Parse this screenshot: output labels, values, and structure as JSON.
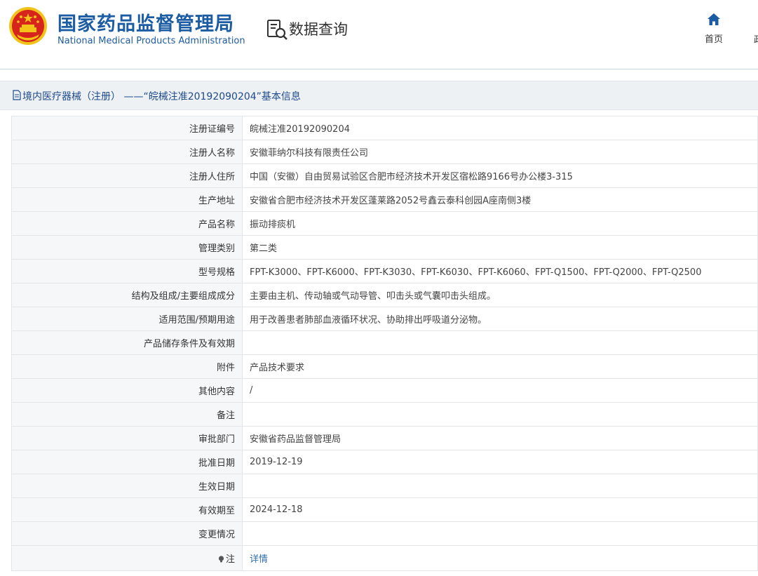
{
  "header": {
    "org_name_cn": "国家药品监督管理局",
    "org_name_en": "National Medical Products Administration",
    "section_title": "数据查询",
    "nav_home": "首页",
    "nav_next_partial": "政"
  },
  "page": {
    "title": "境内医疗器械（注册） ——“皖械注准20192090204”基本信息"
  },
  "rows": [
    {
      "label": "注册证编号",
      "value": "皖械注准20192090204"
    },
    {
      "label": "注册人名称",
      "value": "安徽菲纳尔科技有限责任公司"
    },
    {
      "label": "注册人住所",
      "value": "中国（安徽）自由贸易试验区合肥市经济技术开发区宿松路9166号办公楼3-315"
    },
    {
      "label": "生产地址",
      "value": "安徽省合肥市经济技术开发区蓬莱路2052号鑫云泰科创园A座南侧3楼"
    },
    {
      "label": "产品名称",
      "value": "振动排痰机"
    },
    {
      "label": "管理类别",
      "value": "第二类"
    },
    {
      "label": "型号规格",
      "value": "FPT-K3000、FPT-K6000、FPT-K3030、FPT-K6030、FPT-K6060、FPT-Q1500、FPT-Q2000、FPT-Q2500"
    },
    {
      "label": "结构及组成/主要组成成分",
      "value": "主要由主机、传动轴或气动导管、叩击头或气囊叩击头组成。"
    },
    {
      "label": "适用范围/预期用途",
      "value": "用于改善患者肺部血液循环状况、协助排出呼吸道分泌物。"
    },
    {
      "label": "产品储存条件及有效期",
      "value": ""
    },
    {
      "label": "附件",
      "value": "产品技术要求"
    },
    {
      "label": "其他内容",
      "value": "/"
    },
    {
      "label": "备注",
      "value": ""
    },
    {
      "label": "审批部门",
      "value": "安徽省药品监督管理局"
    },
    {
      "label": "批准日期",
      "value": "2019-12-19"
    },
    {
      "label": "生效日期",
      "value": ""
    },
    {
      "label": "有效期至",
      "value": "2024-12-18"
    },
    {
      "label": "变更情况",
      "value": ""
    }
  ],
  "note_row": {
    "label": "注",
    "link": "详情"
  },
  "colors": {
    "brand_blue": "#1c5ca3",
    "title_blue": "#1c4a8a",
    "link_blue": "#2e6ea8",
    "emblem_red": "#d7251d",
    "emblem_gold": "#f3c318"
  }
}
